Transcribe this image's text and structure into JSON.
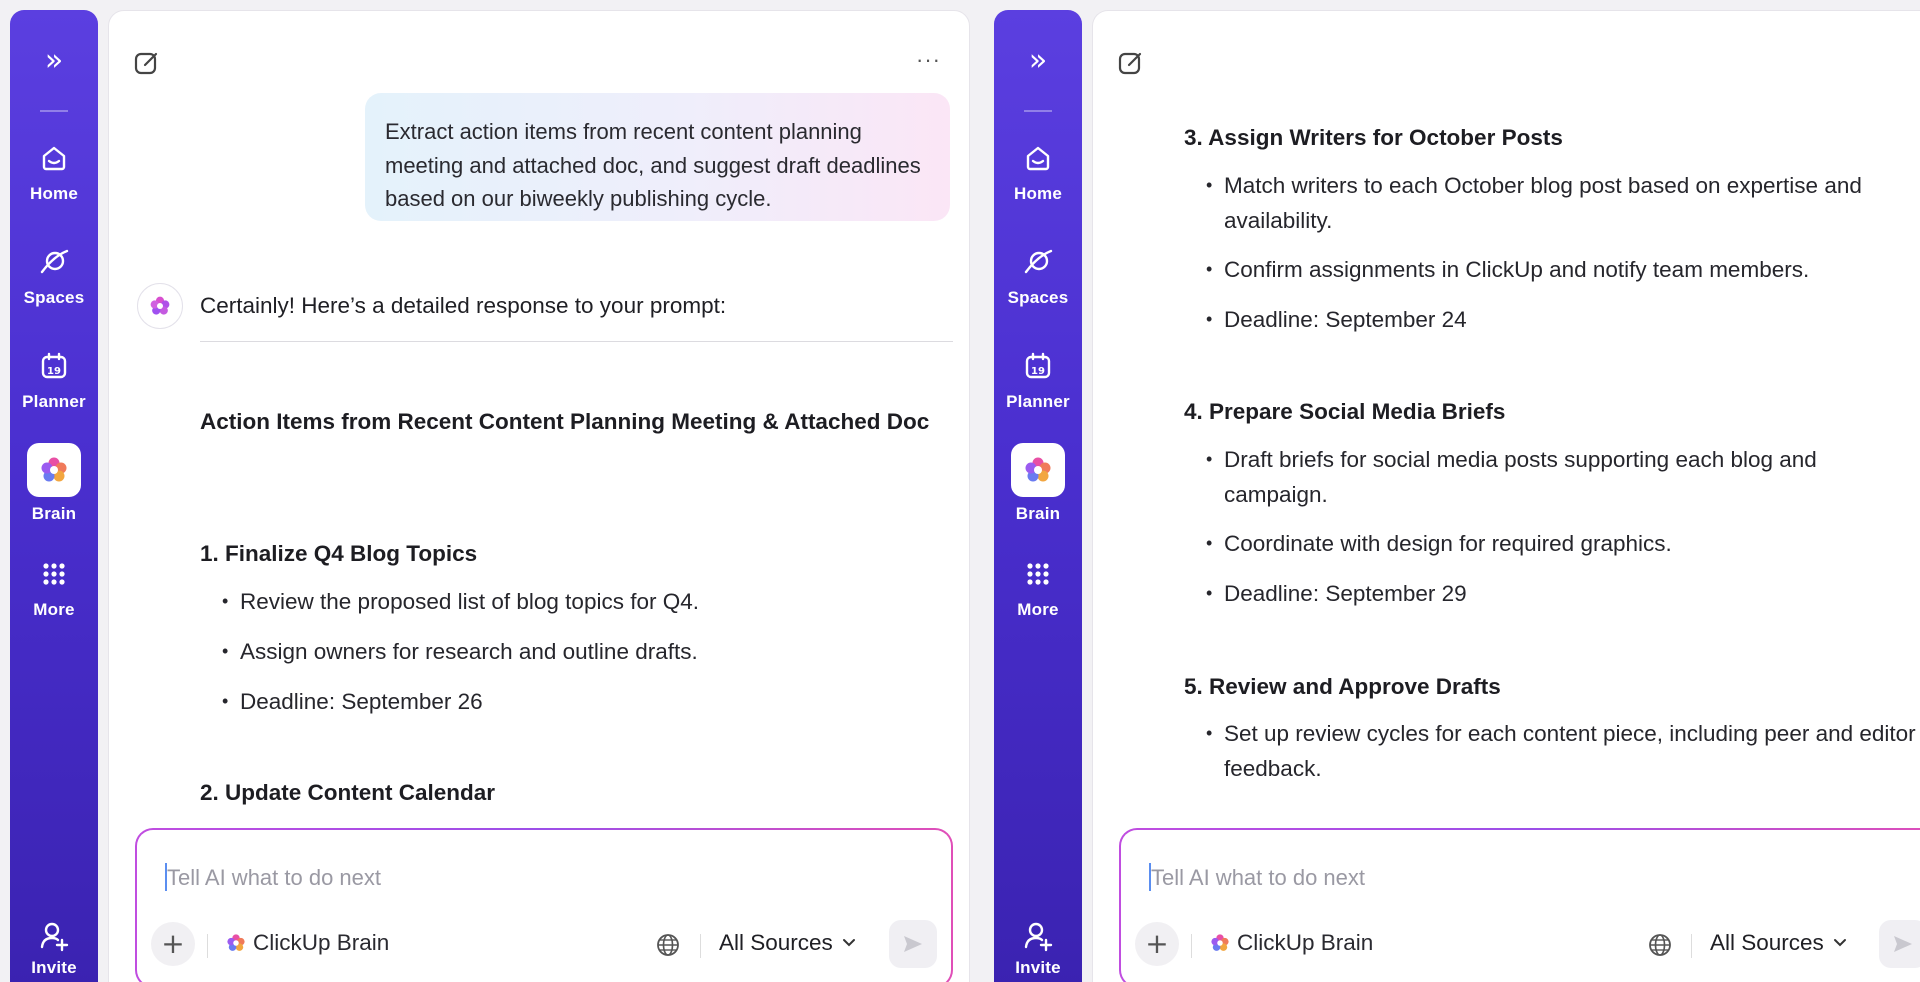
{
  "nav": {
    "home": "Home",
    "spaces": "Spaces",
    "planner": "Planner",
    "planner_day": "19",
    "brain": "Brain",
    "more": "More",
    "invite": "Invite"
  },
  "left_panel": {
    "prompt": "Extract action items from recent content planning meeting and attached doc, and suggest draft deadlines based on our biweekly publishing cycle.",
    "reply_intro": "Certainly! Here’s a detailed response to your prompt:",
    "doc_heading": "Action Items from Recent Content Planning Meeting & Attached Doc",
    "section1": {
      "title": "1. Finalize Q4 Blog Topics",
      "bullets": [
        "Review the proposed list of blog topics for Q4.",
        "Assign owners for research and outline drafts.",
        "Deadline: September 26"
      ]
    },
    "section2_title": "2. Update Content Calendar"
  },
  "right_panel": {
    "section3": {
      "title": "3. Assign Writers for October Posts",
      "bullets": [
        "Match writers to each October blog post based on expertise and availability.",
        "Confirm assignments in ClickUp and notify team members.",
        "Deadline: September 24"
      ]
    },
    "section4": {
      "title": "4. Prepare Social Media Briefs",
      "bullets": [
        "Draft briefs for social media posts supporting each blog and campaign.",
        "Coordinate with design for required graphics.",
        "Deadline: September 29"
      ]
    },
    "section5": {
      "title": "5. Review and Approve Drafts",
      "bullets": [
        "Set up review cycles for each content piece, including peer and editor feedback."
      ]
    }
  },
  "composer": {
    "placeholder": "Tell AI what to do next",
    "brain_label": "ClickUp Brain",
    "sources_label": "All Sources"
  },
  "colors": {
    "rail_top": "#5b3fe0",
    "rail_bottom": "#3a22b0",
    "accent_pink": "#e04fb8"
  }
}
